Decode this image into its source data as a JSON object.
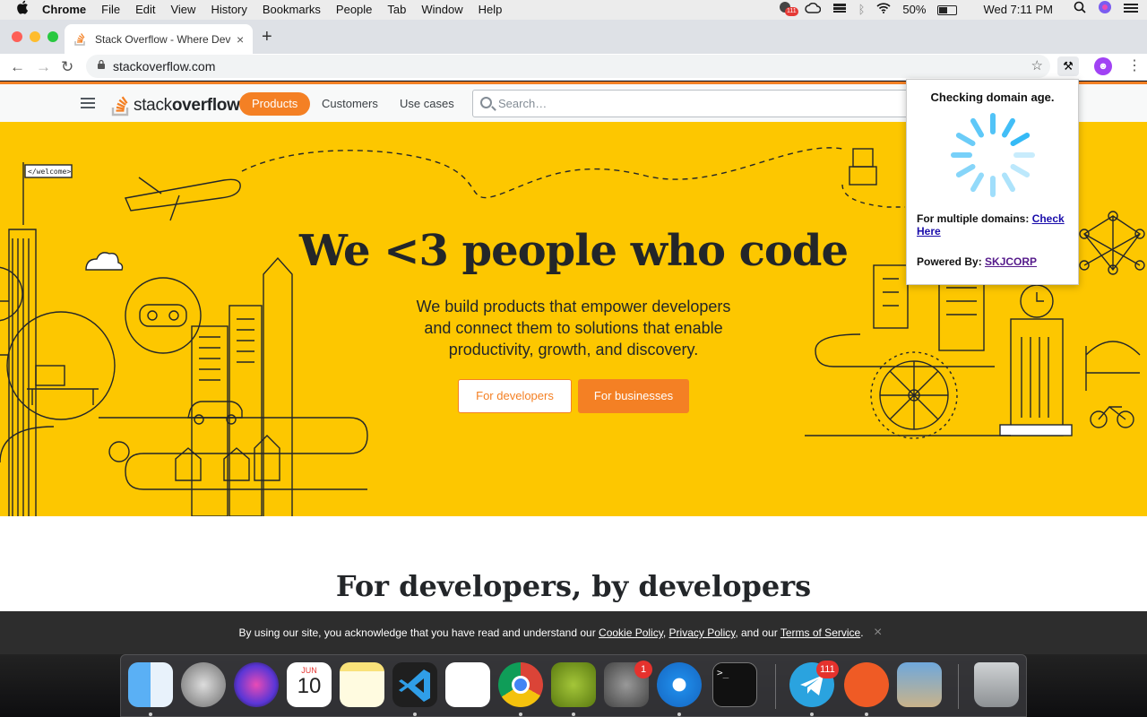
{
  "menubar": {
    "app": "Chrome",
    "items": [
      "File",
      "Edit",
      "View",
      "History",
      "Bookmarks",
      "People",
      "Tab",
      "Window",
      "Help"
    ],
    "status_badge": "111",
    "battery": "50%",
    "battery_level": 0.5,
    "clock": "Wed 7:11 PM"
  },
  "browser": {
    "tab_title": "Stack Overflow - Where Developers Learn, Share, & Build Careers",
    "url": "stackoverflow.com"
  },
  "site": {
    "logo_light": "stack",
    "logo_bold": "overflow",
    "nav_products": "Products",
    "nav_customers": "Customers",
    "nav_use_cases": "Use cases",
    "search_placeholder": "Search…",
    "hero_title": "We <3 people who code",
    "hero_text": "We build products that empower developers and connect them to solutions that enable productivity, growth, and discovery.",
    "btn_developers": "For developers",
    "btn_businesses": "For businesses",
    "section_title": "For developers, by developers",
    "sign_text": "</welcome>"
  },
  "popup": {
    "heading": "Checking domain age.",
    "multiple_label": "For multiple domains:",
    "multiple_link": "Check Here",
    "powered_label": "Powered By:",
    "powered_link": "SKJCORP",
    "spinner_color": "#29b6f6"
  },
  "cookie": {
    "text_1": "By using our site, you acknowledge that you have read and understand our",
    "link_cookie": "Cookie Policy",
    "sep_1": ",",
    "link_privacy": "Privacy Policy",
    "text_2": ", and our",
    "link_terms": "Terms of Service",
    "text_3": ".",
    "close": "×"
  },
  "dock": {
    "calendar_month": "JUN",
    "calendar_day": "10",
    "sysprefs_badge": "1",
    "telegram_badge": "111",
    "terminal_prompt": ">_"
  },
  "colors": {
    "so_orange": "#f48024",
    "hero_yellow": "#fdc700"
  }
}
